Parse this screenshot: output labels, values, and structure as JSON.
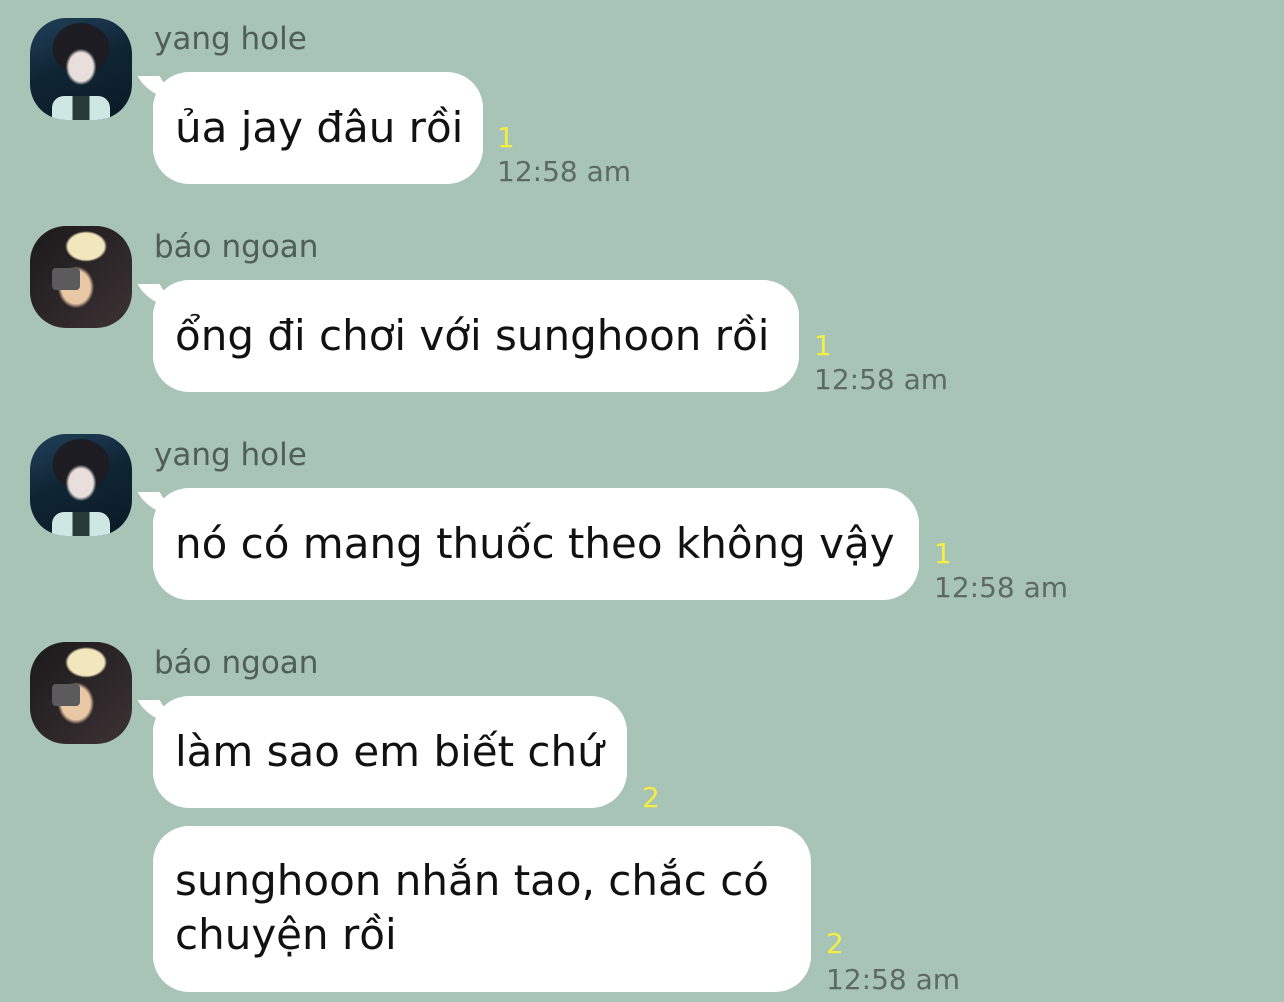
{
  "messages": [
    {
      "sender": "yang hole",
      "avatar": "dark-hair-avatar",
      "text": "ủa jay đâu rồi",
      "unread": "1",
      "time": "12:58 am"
    },
    {
      "sender": "báo ngoan",
      "avatar": "blond-hair-avatar",
      "text": "ổng đi chơi với sunghoon rồi",
      "unread": "1",
      "time": "12:58 am"
    },
    {
      "sender": "yang hole",
      "avatar": "dark-hair-avatar",
      "text": "nó có mang thuốc theo không vậy",
      "unread": "1",
      "time": "12:58 am"
    },
    {
      "sender": "báo ngoan",
      "avatar": "blond-hair-avatar",
      "text": "làm sao em biết chứ",
      "unread": "2",
      "time": ""
    },
    {
      "sender": "",
      "avatar": "",
      "text_line1": "sunghoon nhắn tao, chắc có",
      "text_line2": "chuyện rồi",
      "unread": "2",
      "time": "12:58 am"
    }
  ],
  "colors": {
    "background": "#a7c4b7",
    "bubble": "#ffffff",
    "unread_count": "#f4ee42",
    "timestamp": "#5d6a64",
    "sender_name": "#4f5e57"
  }
}
